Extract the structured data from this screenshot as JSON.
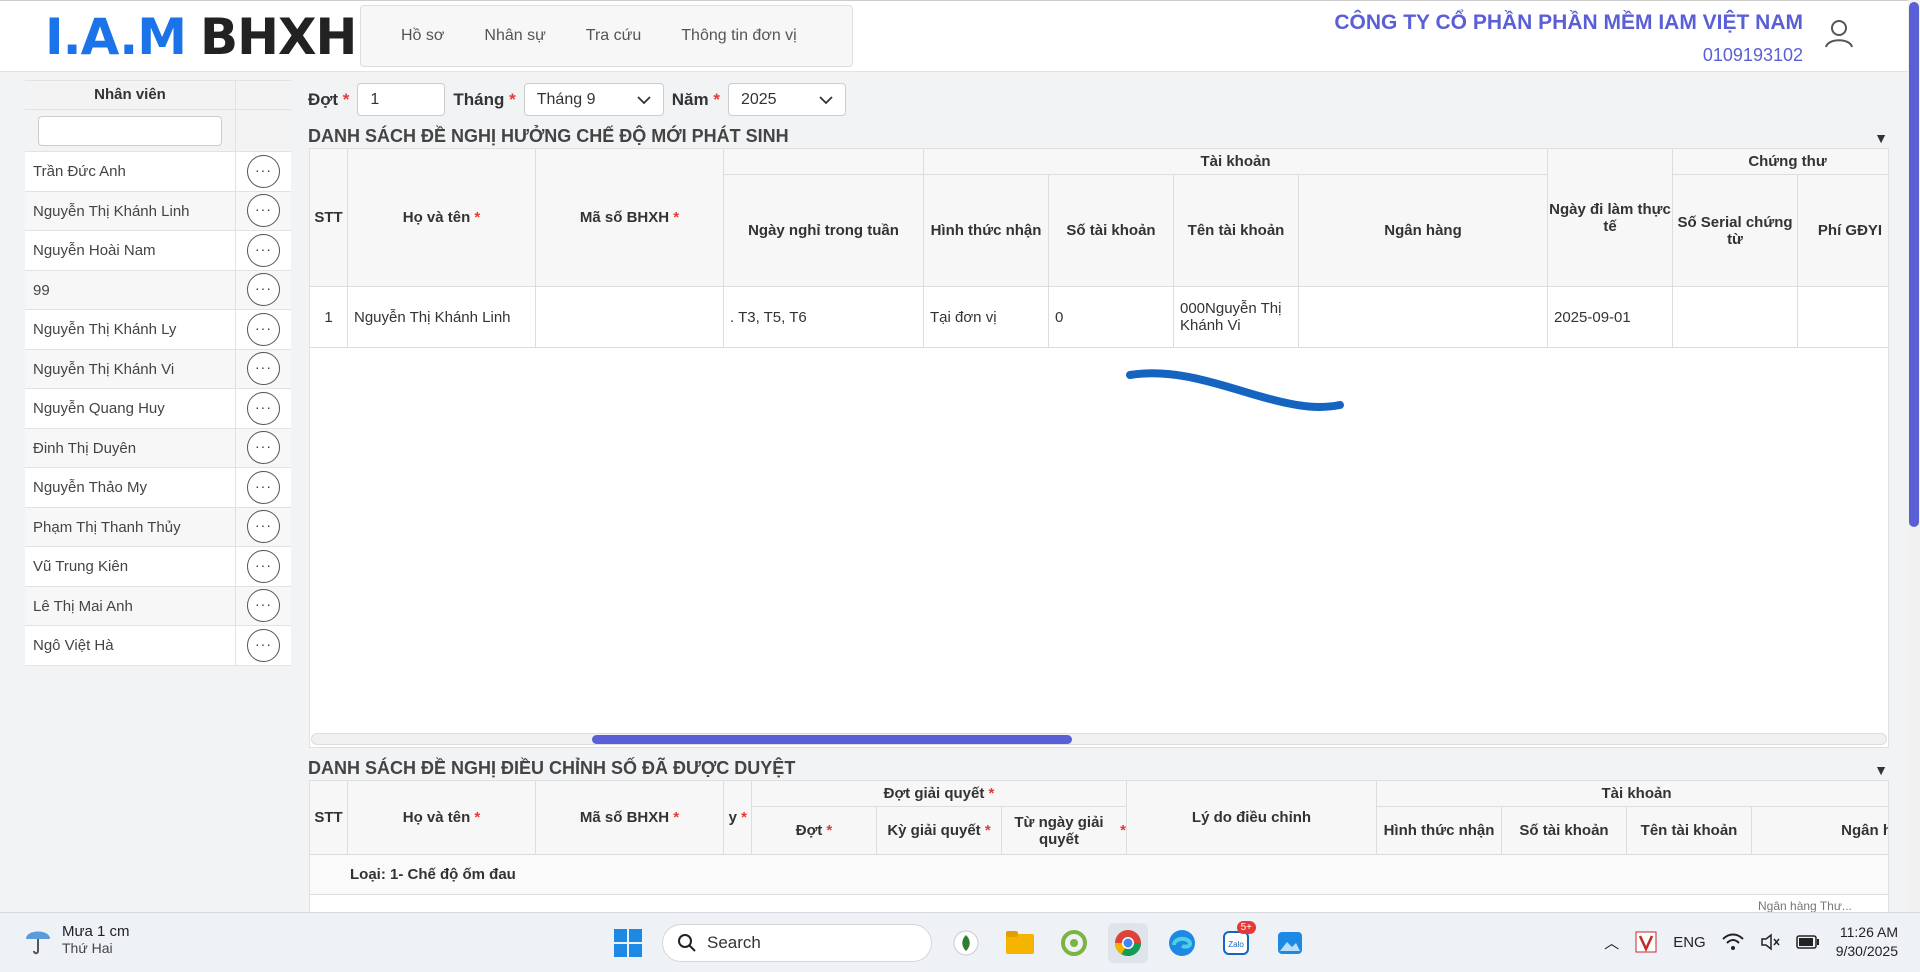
{
  "header": {
    "logo_iam": "I.A.M",
    "logo_bhxh": "BHXH",
    "nav": [
      "Hồ sơ",
      "Nhân sự",
      "Tra cứu",
      "Thông tin đơn vị"
    ],
    "company_name": "CÔNG TY CỔ PHẦN PHẦN MỀM IAM VIỆT NAM",
    "tax_code": "0109193102"
  },
  "sidebar": {
    "header": "Nhân viên",
    "filter_value": "",
    "employees": [
      "Trần Đức Anh",
      "Nguyễn Thị Khánh Linh",
      "Nguyễn Hoài Nam",
      "99",
      "Nguyễn Thị Khánh Ly",
      "Nguyễn Thị Khánh Vi",
      "Nguyễn Quang Huy",
      "Đinh Thị Duyên",
      "Nguyễn Thảo My",
      "Phạm Thị Thanh Thủy",
      "Vũ Trung Kiên",
      "Lê Thị Mai Anh",
      "Ngô Việt Hà"
    ],
    "action_glyph": "···"
  },
  "filters": {
    "dot_label": "Đợt",
    "dot_value": "1",
    "thang_label": "Tháng",
    "thang_value": "Tháng 9",
    "nam_label": "Năm",
    "nam_value": "2025",
    "required_mark": "*"
  },
  "section1": {
    "title": "DANH SÁCH ĐỀ NGHỊ HƯỞNG CHẾ ĐỘ MỚI PHÁT SINH",
    "h_stt": "STT",
    "h_hoten": "Họ và tên",
    "h_mabhxh": "Mã số BHXH",
    "h_ngaynghi": "Ngày nghỉ trong tuần",
    "g_taikhoan": "Tài khoản",
    "h_hinhthuc": "Hình thức nhận",
    "h_sotk": "Số tài khoản",
    "h_tentk": "Tên tài khoản",
    "h_nganhang": "Ngân hàng",
    "h_ngaydilam": "Ngày đi làm thực tế",
    "g_chungthu": "Chứng thư",
    "h_serial": "Số Serial chứng từ",
    "h_phi": "Phí GĐYI",
    "row": {
      "stt": "1",
      "hoten": "Nguyễn Thị Khánh Linh",
      "mabhxh": "",
      "ngaynghi": ". T3, T5, T6",
      "hinhthuc": "Tại đơn vị",
      "sotk": "0",
      "tentk": "000Nguyễn Thị Khánh Vi",
      "nganhang": "",
      "ngaydilam": "2025-09-01"
    }
  },
  "section2": {
    "title": "DANH SÁCH ĐỀ NGHỊ ĐIỀU CHỈNH SỐ ĐÃ ĐƯỢC DUYỆT",
    "h_stt": "STT",
    "h_hoten": "Họ và tên",
    "h_mabhxh": "Mã số BHXH",
    "h_y": "y",
    "g_dotgq": "Đợt giải quyết",
    "h_dot": "Đợt",
    "h_ky": "Kỳ giải quyết",
    "h_tungay": "Từ ngày giải quyết",
    "h_lydo": "Lý do điều chỉnh",
    "g_taikhoan": "Tài khoản",
    "h_hinhthuc": "Hình thức nhận",
    "h_sotk": "Số tài khoản",
    "h_tentk": "Tên tài khoản",
    "h_nganhang": "Ngân h",
    "group_row": "Loại: 1- Chế độ ốm đau",
    "partial_cell": "Ngân hàng Thư..."
  },
  "taskbar": {
    "weather_title": "Mưa 1 cm",
    "weather_sub": "Thứ Hai",
    "search_placeholder": "Search",
    "zalo_badge": "5+",
    "lang": "ENG",
    "time": "11:26 AM",
    "date": "9/30/2025"
  }
}
